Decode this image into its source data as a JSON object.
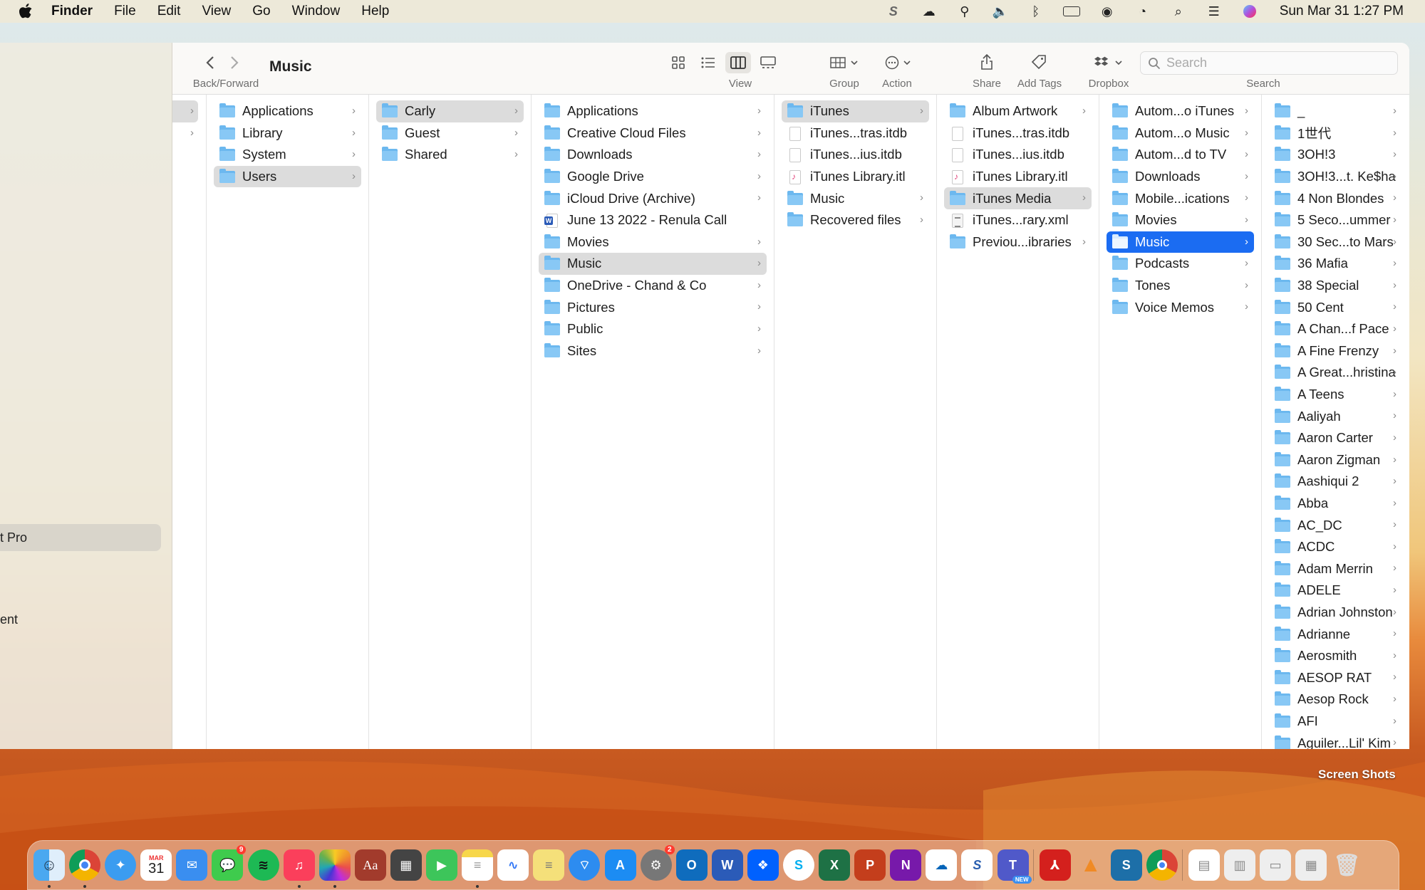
{
  "menubar": {
    "app": "Finder",
    "items": [
      "File",
      "Edit",
      "View",
      "Go",
      "Window",
      "Help"
    ],
    "clock": "Sun Mar 31  1:27 PM"
  },
  "sidebar_peek": {
    "selected_partial": "t Pro",
    "partial_item": "ent"
  },
  "toolbar": {
    "title": "Music",
    "back_forward_label": "Back/Forward",
    "view_label": "View",
    "group_label": "Group",
    "action_label": "Action",
    "share_label": "Share",
    "add_tags_label": "Add Tags",
    "dropbox_label": "Dropbox",
    "search_label": "Search",
    "search_placeholder": "Search"
  },
  "columns": {
    "col_root": [
      "Applications",
      "Library",
      "System",
      "Users"
    ],
    "col_users": [
      "Carly",
      "Guest",
      "Shared"
    ],
    "col_carly": [
      "Applications",
      "Creative Cloud Files",
      "Downloads",
      "Google Drive",
      "iCloud Drive (Archive)",
      "June 13 2022 - Renula Call",
      "Movies",
      "Music",
      "OneDrive - Chand & Co",
      "Pictures",
      "Public",
      "Sites"
    ],
    "col_music": [
      "iTunes",
      "iTunes...tras.itdb",
      "iTunes...ius.itdb",
      "iTunes Library.itl",
      "Music",
      "Recovered files"
    ],
    "col_itunes": [
      "Album Artwork",
      "iTunes...tras.itdb",
      "iTunes...ius.itdb",
      "iTunes Library.itl",
      "iTunes Media",
      "iTunes...rary.xml",
      "Previou...ibraries"
    ],
    "col_media": [
      "Autom...o iTunes",
      "Autom...o Music",
      "Autom...d to TV",
      "Downloads",
      "Mobile...ications",
      "Movies",
      "Music",
      "Podcasts",
      "Tones",
      "Voice Memos"
    ],
    "col_artists": [
      "_",
      "1世代",
      "3OH!3",
      "3OH!3...t. Ke$ha",
      "4 Non Blondes",
      "5 Seco...ummer",
      "30 Sec...to Mars",
      "36 Mafia",
      "38 Special",
      "50 Cent",
      "A Chan...f Pace",
      "A Fine Frenzy",
      "A Great...hristina",
      "A Teens",
      "Aaliyah",
      "Aaron Carter",
      "Aaron Zigman",
      "Aashiqui 2",
      "Abba",
      "AC_DC",
      "ACDC",
      "Adam Merrin",
      "ADELE",
      "Adrian Johnston",
      "Adrianne",
      "Aerosmith",
      "AESOP RAT",
      "Aesop Rock",
      "AFI",
      "Aguiler...Lil' Kim"
    ]
  },
  "dock": {
    "calendar_month": "MAR",
    "calendar_day": "31",
    "messages_badge": "9",
    "settings_badge": "2",
    "new_badge": "NEW"
  },
  "desktop": {
    "label": "Screen Shots"
  },
  "colors": {
    "selection_blue": "#1b6cf2",
    "folder_blue": "#6cb8ef"
  }
}
